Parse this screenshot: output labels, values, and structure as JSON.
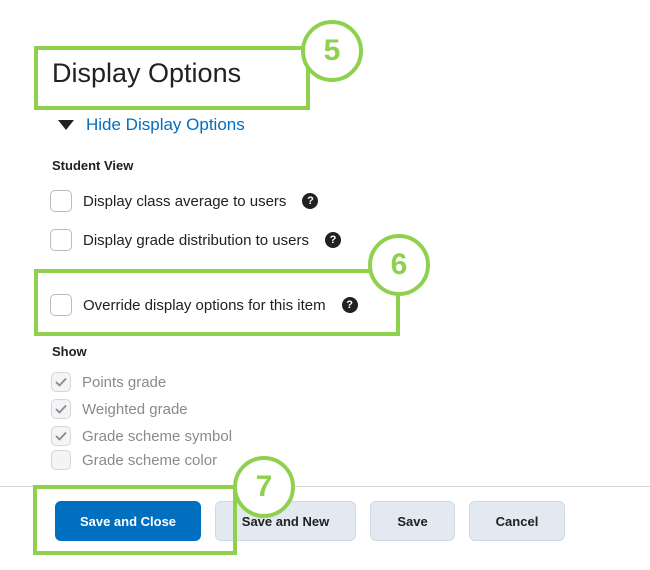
{
  "header": {
    "title": "Display Options",
    "toggle_label": "Hide Display Options"
  },
  "student_view": {
    "heading": "Student View",
    "options": [
      {
        "label": "Display class average to users",
        "checked": false
      },
      {
        "label": "Display grade distribution to users",
        "checked": false
      },
      {
        "label": "Override display options for this item",
        "checked": false
      }
    ]
  },
  "show": {
    "heading": "Show",
    "options": [
      {
        "label": "Points grade",
        "checked": true,
        "disabled": true
      },
      {
        "label": "Weighted grade",
        "checked": true,
        "disabled": true
      },
      {
        "label": "Grade scheme symbol",
        "checked": true,
        "disabled": true
      },
      {
        "label": "Grade scheme color",
        "checked": false,
        "disabled": true
      }
    ]
  },
  "footer": {
    "save_close_label": "Save and Close",
    "save_new_label": "Save and New",
    "save_label": "Save",
    "cancel_label": "Cancel"
  },
  "annotations": {
    "badge_5": "5",
    "badge_6": "6",
    "badge_7": "7",
    "highlight_color": "#8fd14f"
  },
  "icons": {
    "help": "question-circle-icon",
    "check": "checkmark-icon",
    "triangle": "triangle-down-icon"
  },
  "colors": {
    "primary": "#006fbf",
    "link": "#006fbf",
    "text": "#202122"
  }
}
